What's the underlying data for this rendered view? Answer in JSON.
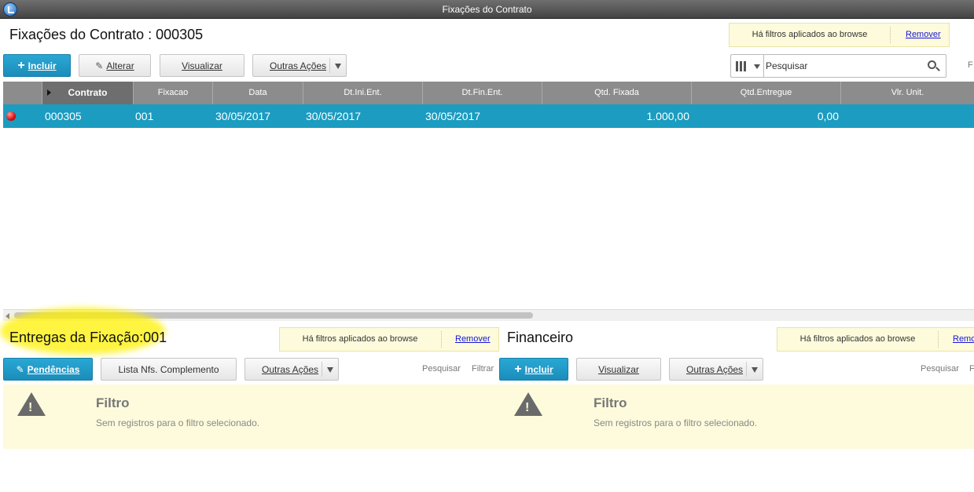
{
  "window": {
    "title": "Fixações do Contrato"
  },
  "top": {
    "title": "Fixações do Contrato : 000305",
    "filter_msg": "Há filtros aplicados ao browse",
    "filter_remove": "Remover",
    "buttons": {
      "incluir": "Incluir",
      "alterar": "Alterar",
      "visualizar": "Visualizar",
      "outras": "Outras Ações"
    },
    "search_placeholder": "Pesquisar",
    "cut_label": "F"
  },
  "grid": {
    "columns": [
      "Contrato",
      "Fixacao",
      "Data",
      "Dt.Ini.Ent.",
      "Dt.Fin.Ent.",
      "Qtd. Fixada",
      "Qtd.Entregue",
      "Vlr. Unit."
    ],
    "rows": [
      {
        "status_color": "#d51010",
        "contrato": "000305",
        "fixacao": "001",
        "data": "30/05/2017",
        "dt_ini": "30/05/2017",
        "dt_fin": "30/05/2017",
        "qtd_fixada": "1.000,00",
        "qtd_entregue": "0,00",
        "vlr_unit": ""
      }
    ]
  },
  "entregas": {
    "title": "Entregas da Fixação:001",
    "filter_msg": "Há filtros aplicados ao browse",
    "filter_remove": "Remover",
    "buttons": {
      "pendencias": "Pendências",
      "lista": "Lista Nfs. Complemento",
      "outras": "Outras Ações"
    },
    "search": "Pesquisar",
    "filter": "Filtrar",
    "empty_title": "Filtro",
    "empty_msg": "Sem registros para o filtro selecionado."
  },
  "financeiro": {
    "title": "Financeiro",
    "filter_msg": "Há filtros aplicados ao browse",
    "filter_remove": "Remo",
    "buttons": {
      "incluir": "Incluir",
      "visualizar": "Visualizar",
      "outras": "Outras Ações"
    },
    "search": "Pesquisar",
    "cut_label": "F",
    "empty_title": "Filtro",
    "empty_msg": "Sem registros para o filtro selecionado."
  },
  "colors": {
    "accent": "#1b9cc0",
    "header": "#8c8c8c",
    "filter_bg": "#fdfbdc",
    "highlight": "#fff000"
  }
}
